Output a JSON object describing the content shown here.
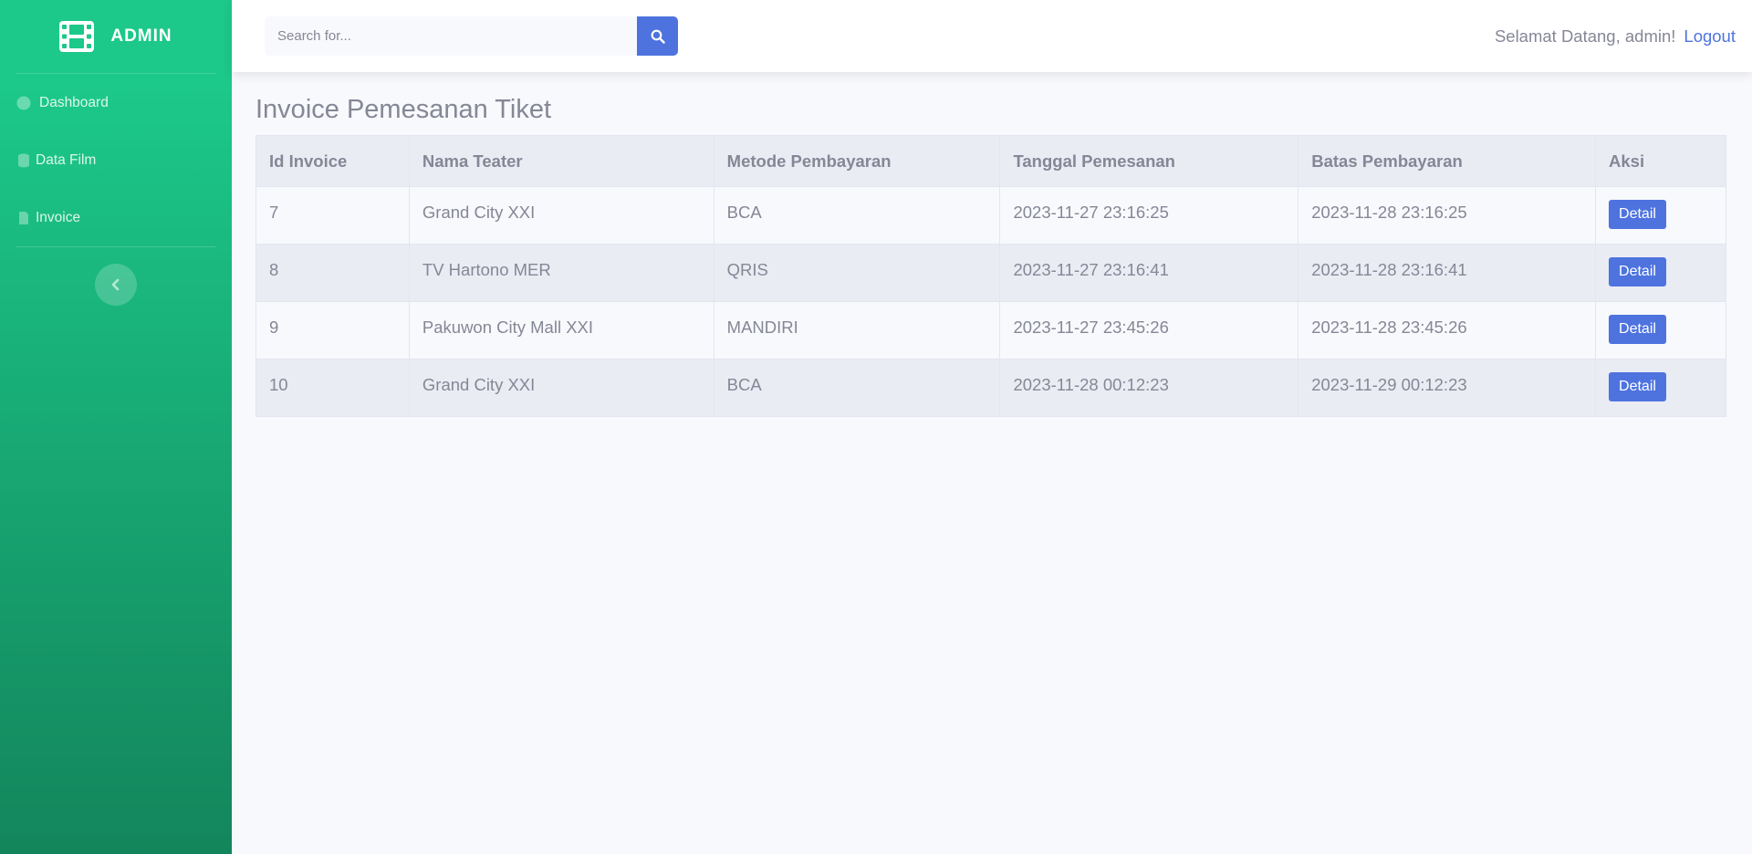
{
  "brand": {
    "name": "ADMIN"
  },
  "sidebar": {
    "items": [
      {
        "label": "Dashboard",
        "icon": "dashboard-icon"
      },
      {
        "label": "Data Film",
        "icon": "database-icon"
      },
      {
        "label": "Invoice",
        "icon": "file-icon"
      }
    ]
  },
  "topbar": {
    "search_placeholder": "Search for...",
    "welcome": "Selamat Datang, admin!",
    "logout": "Logout"
  },
  "page": {
    "title": "Invoice Pemesanan Tiket"
  },
  "table": {
    "headers": [
      "Id Invoice",
      "Nama Teater",
      "Metode Pembayaran",
      "Tanggal Pemesanan",
      "Batas Pembayaran",
      "Aksi"
    ],
    "rows": [
      {
        "id": "7",
        "teater": "Grand City XXI",
        "metode": "BCA",
        "tanggal": "2023-11-27 23:16:25",
        "batas": "2023-11-28 23:16:25",
        "aksi": "Detail"
      },
      {
        "id": "8",
        "teater": "TV Hartono MER",
        "metode": "QRIS",
        "tanggal": "2023-11-27 23:16:41",
        "batas": "2023-11-28 23:16:41",
        "aksi": "Detail"
      },
      {
        "id": "9",
        "teater": "Pakuwon City Mall XXI",
        "metode": "MANDIRI",
        "tanggal": "2023-11-27 23:45:26",
        "batas": "2023-11-28 23:45:26",
        "aksi": "Detail"
      },
      {
        "id": "10",
        "teater": "Grand City XXI",
        "metode": "BCA",
        "tanggal": "2023-11-28 00:12:23",
        "batas": "2023-11-29 00:12:23",
        "aksi": "Detail"
      }
    ]
  },
  "colors": {
    "primary": "#4e73df",
    "sidebar_start": "#1cc88a",
    "sidebar_end": "#13855c"
  }
}
